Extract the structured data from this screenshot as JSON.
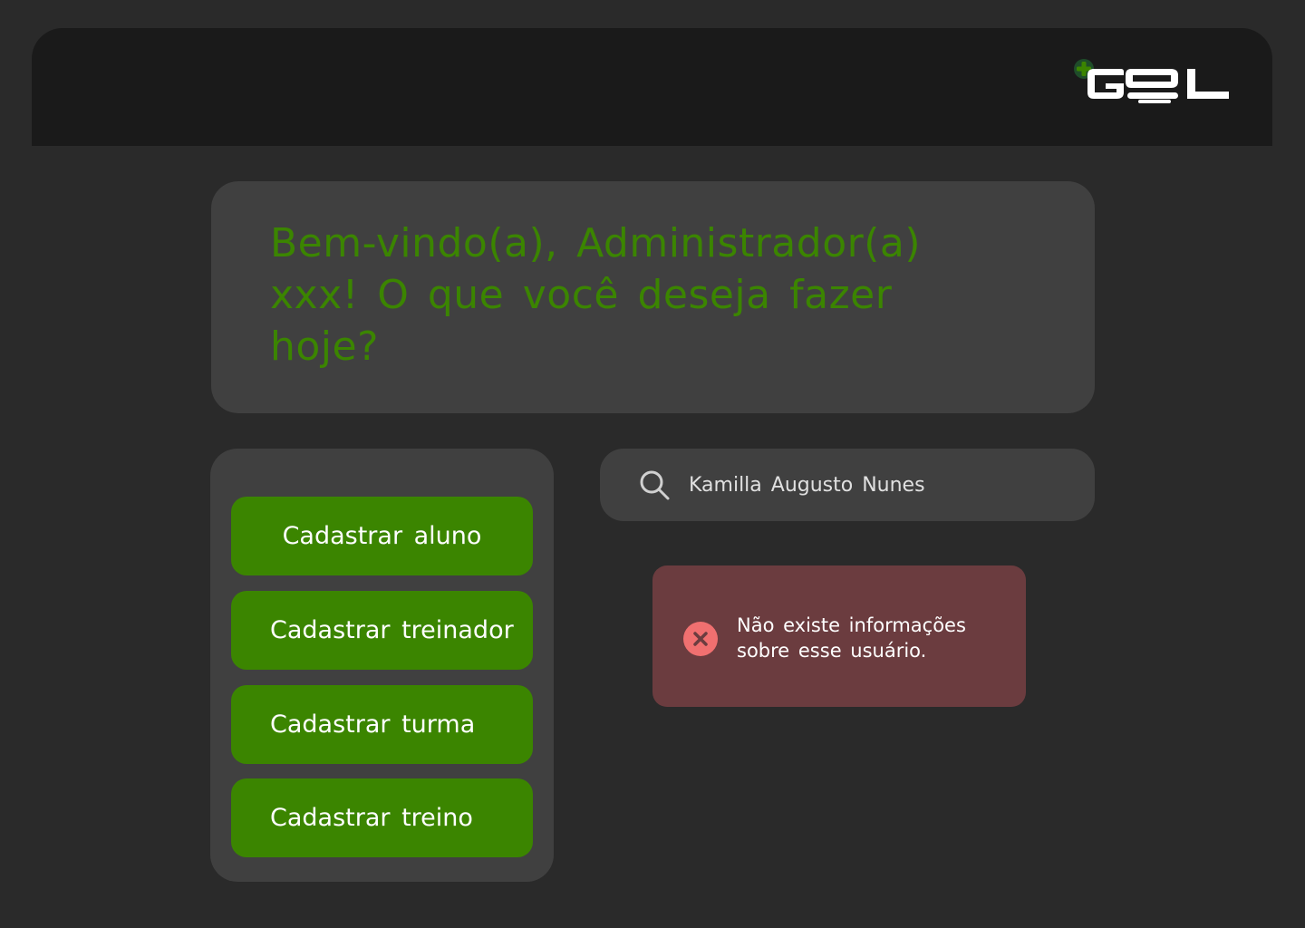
{
  "header": {
    "logo_text": "GOL"
  },
  "welcome": {
    "message": "Bem-vindo(a), Administrador(a) xxx! O que você deseja fazer hoje?"
  },
  "menu": {
    "items": [
      {
        "label": "Cadastrar aluno"
      },
      {
        "label": "Cadastrar treinador"
      },
      {
        "label": "Cadastrar turma"
      },
      {
        "label": "Cadastrar treino"
      }
    ]
  },
  "search": {
    "value": "Kamilla Augusto Nunes",
    "icon": "search-icon"
  },
  "alert": {
    "message": "Não existe informações sobre esse usuário.",
    "icon": "close-circle-icon"
  },
  "colors": {
    "background": "#2a2a2a",
    "header": "#1a1a1a",
    "card": "#404040",
    "accent_green": "#3b8500",
    "alert_background": "#6b3c3f",
    "alert_icon": "#f07070",
    "logo_plus": "#3b8500"
  }
}
